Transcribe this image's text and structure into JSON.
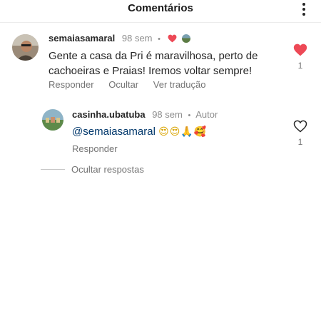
{
  "header": {
    "title": "Comentários"
  },
  "comment": {
    "username": "semaiasamaral",
    "time": "98 sem",
    "text": "Gente a casa da Pri é maravilhosa, perto de cachoeiras e Praias! Iremos voltar sempre!",
    "like_count": "1",
    "liked": true,
    "actions": {
      "reply": "Responder",
      "hide": "Ocultar",
      "translate": "Ver tradução"
    }
  },
  "reply": {
    "username": "casinha.ubatuba",
    "time": "98 sem",
    "author_badge": "Autor",
    "mention": "@semaiasamaral",
    "emojis": "😍😍🙏🥰",
    "like_count": "1",
    "liked": false,
    "actions": {
      "reply": "Responder"
    }
  },
  "hide_replies_label": "Ocultar respostas",
  "colors": {
    "like_red": "#ed4956",
    "mention_blue": "#00376b",
    "muted_gray": "#737373"
  }
}
